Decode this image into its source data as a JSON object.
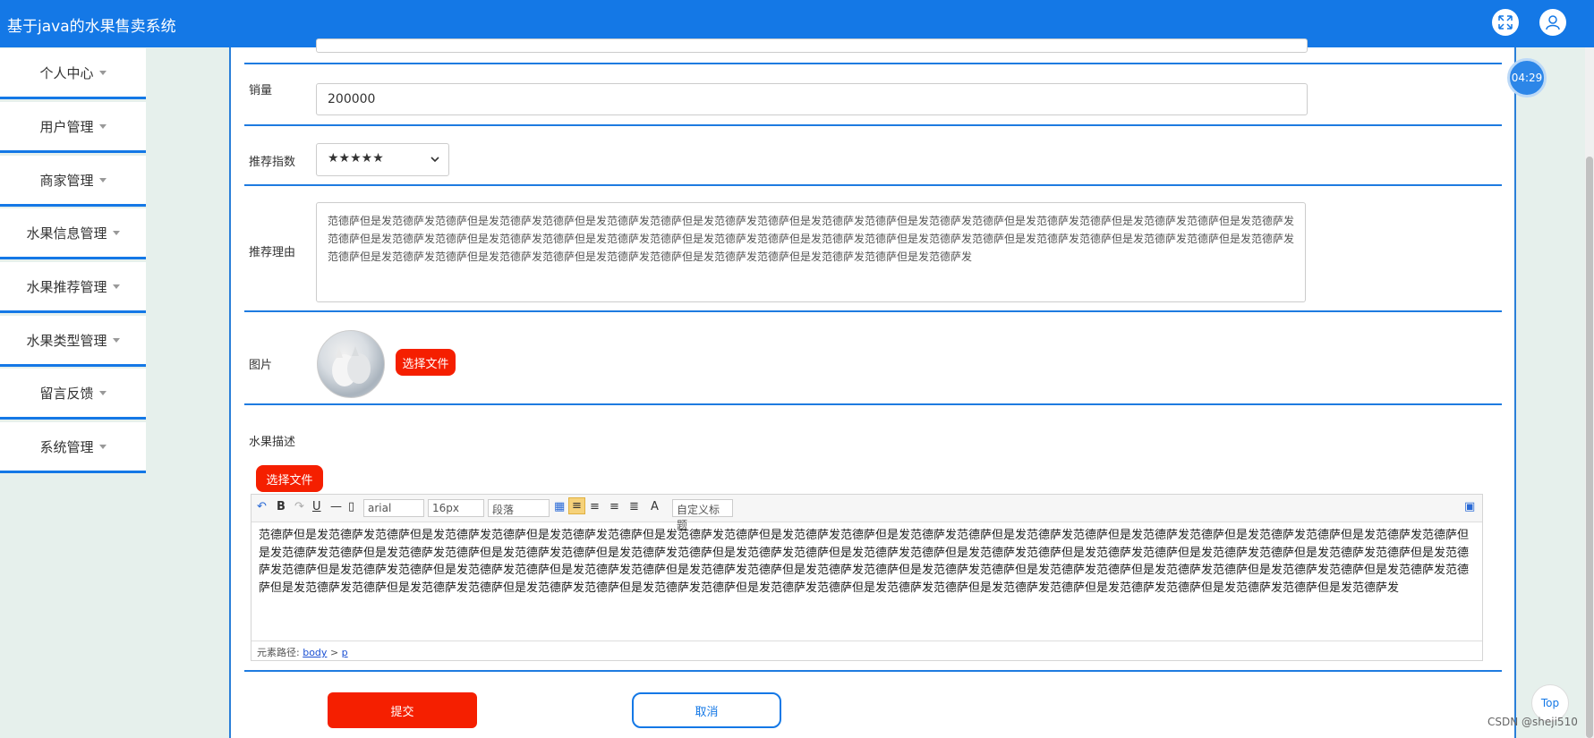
{
  "app": {
    "title": "基于java的水果售卖系统"
  },
  "topbar_icons": {
    "fullscreen": "fullscreen-icon",
    "user": "user-icon"
  },
  "sidebar": {
    "items": [
      {
        "label": "个人中心"
      },
      {
        "label": "用户管理"
      },
      {
        "label": "商家管理"
      },
      {
        "label": "水果信息管理"
      },
      {
        "label": "水果推荐管理"
      },
      {
        "label": "水果类型管理"
      },
      {
        "label": "留言反馈"
      },
      {
        "label": "系统管理"
      }
    ]
  },
  "form": {
    "sales": {
      "label": "销量",
      "value": "200000"
    },
    "rating": {
      "label": "推荐指数",
      "value": "★★★★★"
    },
    "reason": {
      "label": "推荐理由",
      "value": "范德萨但是发范德萨发范德萨但是发范德萨发范德萨但是发范德萨发范德萨但是发范德萨发范德萨但是发范德萨发范德萨但是发范德萨发范德萨但是发范德萨发范德萨但是发范德萨发范德萨但是发范德萨发范德萨但是发范德萨发范德萨但是发范德萨发范德萨但是发范德萨发范德萨但是发范德萨发范德萨但是发范德萨发范德萨但是发范德萨发范德萨但是发范德萨发范德萨但是发范德萨发范德萨但是发范德萨发范德萨但是发范德萨发范德萨但是发范德萨发范德萨但是发范德萨发范德萨但是发范德萨发范德萨但是发范德萨发范德萨但是发范德萨发"
    },
    "image": {
      "label": "图片",
      "button": "选择文件"
    },
    "description": {
      "label": "水果描述",
      "upload_button": "选择文件",
      "toolbar": {
        "font": "arial",
        "size": "16px",
        "block": "段落",
        "custom_title": "自定义标题"
      },
      "content": "范德萨但是发范德萨发范德萨但是发范德萨发范德萨但是发范德萨发范德萨但是发范德萨发范德萨但是发范德萨发范德萨但是发范德萨发范德萨但是发范德萨发范德萨但是发范德萨发范德萨但是发范德萨发范德萨但是发范德萨发范德萨但是发范德萨发范德萨但是发范德萨发范德萨但是发范德萨发范德萨但是发范德萨发范德萨但是发范德萨发范德萨但是发范德萨发范德萨但是发范德萨发范德萨但是发范德萨发范德萨但是发范德萨发范德萨但是发范德萨发范德萨但是发范德萨发范德萨但是发范德萨发范德萨但是发范德萨发范德萨但是发范德萨发范德萨但是发范德萨发范德萨但是发范德萨发范德萨但是发范德萨发范德萨但是发范德萨发范德萨但是发范德萨发范德萨但是发范德萨发范德萨但是发范德萨发范德萨但是发范德萨发范德萨但是发范德萨发范德萨但是发范德萨发范德萨但是发范德萨发范德萨但是发范德萨发范德萨但是发范德萨发范德萨但是发范德萨发范德萨但是发范德萨发范德萨但是发范德萨发范德萨但是发范德萨发",
      "path_label": "元素路径:",
      "path_body": "body",
      "path_sep": ">",
      "path_p": "p"
    },
    "submit": "提交",
    "cancel": "取消"
  },
  "timer": "04:29",
  "top_button": "Top",
  "watermark": "CSDN @sheji510",
  "colors": {
    "primary": "#1478e6",
    "danger": "#f51f00"
  }
}
